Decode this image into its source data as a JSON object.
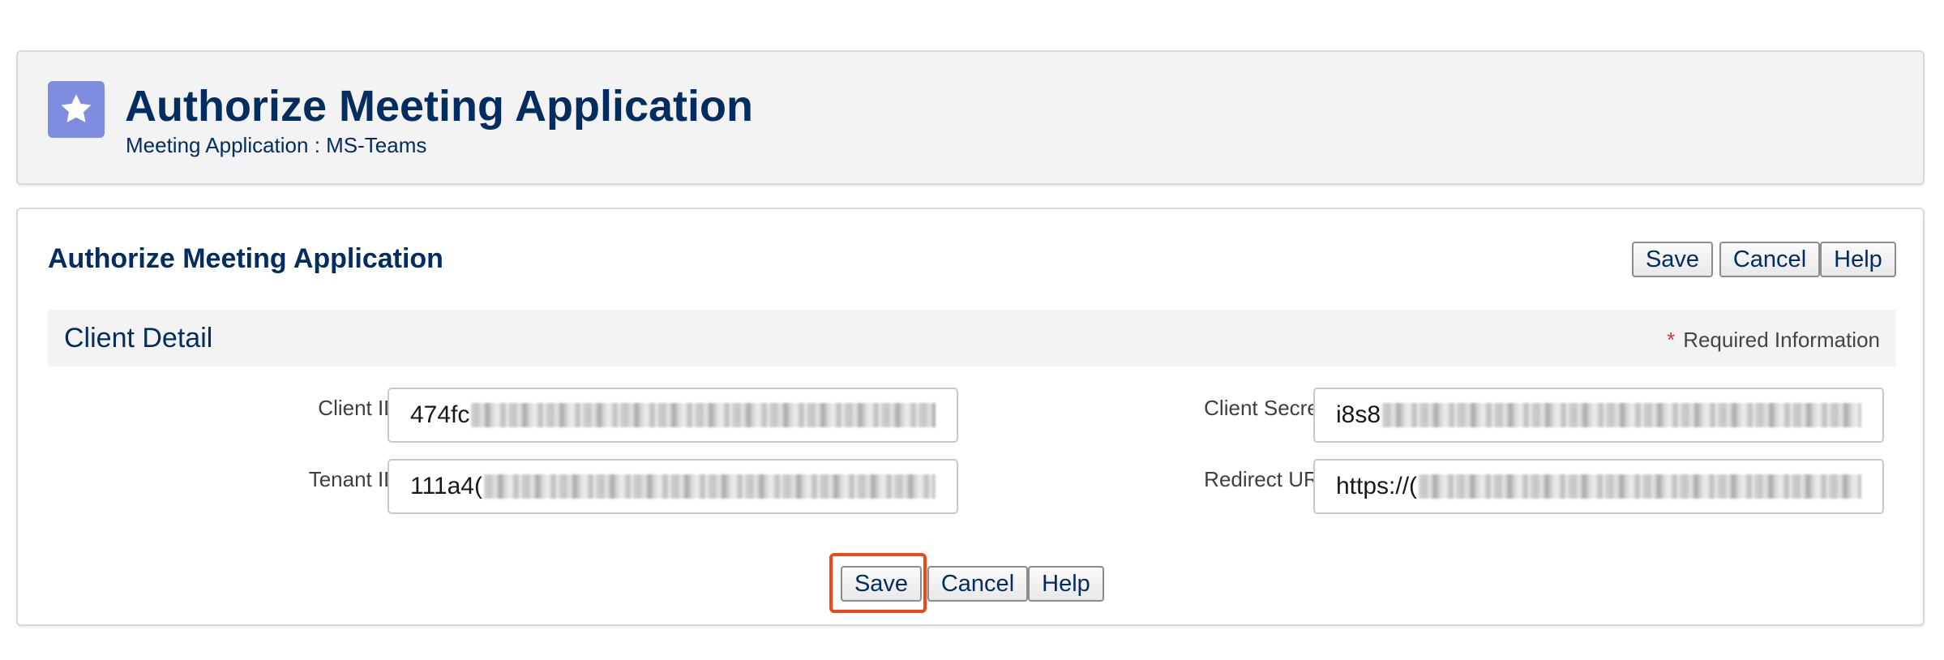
{
  "header": {
    "icon": "star-icon",
    "icon_color": "#7f8de1",
    "title": "Authorize Meeting Application",
    "subtitle": "Meeting Application : MS-Teams"
  },
  "section": {
    "title": "Authorize Meeting Application",
    "top_buttons": {
      "save": "Save",
      "cancel": "Cancel",
      "help": "Help"
    },
    "bottom_buttons": {
      "save": "Save",
      "cancel": "Cancel",
      "help": "Help"
    }
  },
  "client_detail": {
    "title": "Client Detail",
    "required_marker": "*",
    "required_text": "Required Information",
    "fields": {
      "client_id": {
        "label": "Client ID",
        "value": "474fc"
      },
      "client_secret": {
        "label": "Client Secret",
        "value": "i8s8"
      },
      "tenant_id": {
        "label": "Tenant ID",
        "value": "111a4("
      },
      "redirect_uri": {
        "label": "Redirect URI",
        "value": "https://("
      }
    }
  },
  "colors": {
    "text_primary": "#032d60",
    "required_star": "#c23934",
    "highlight": "#e8491d"
  }
}
